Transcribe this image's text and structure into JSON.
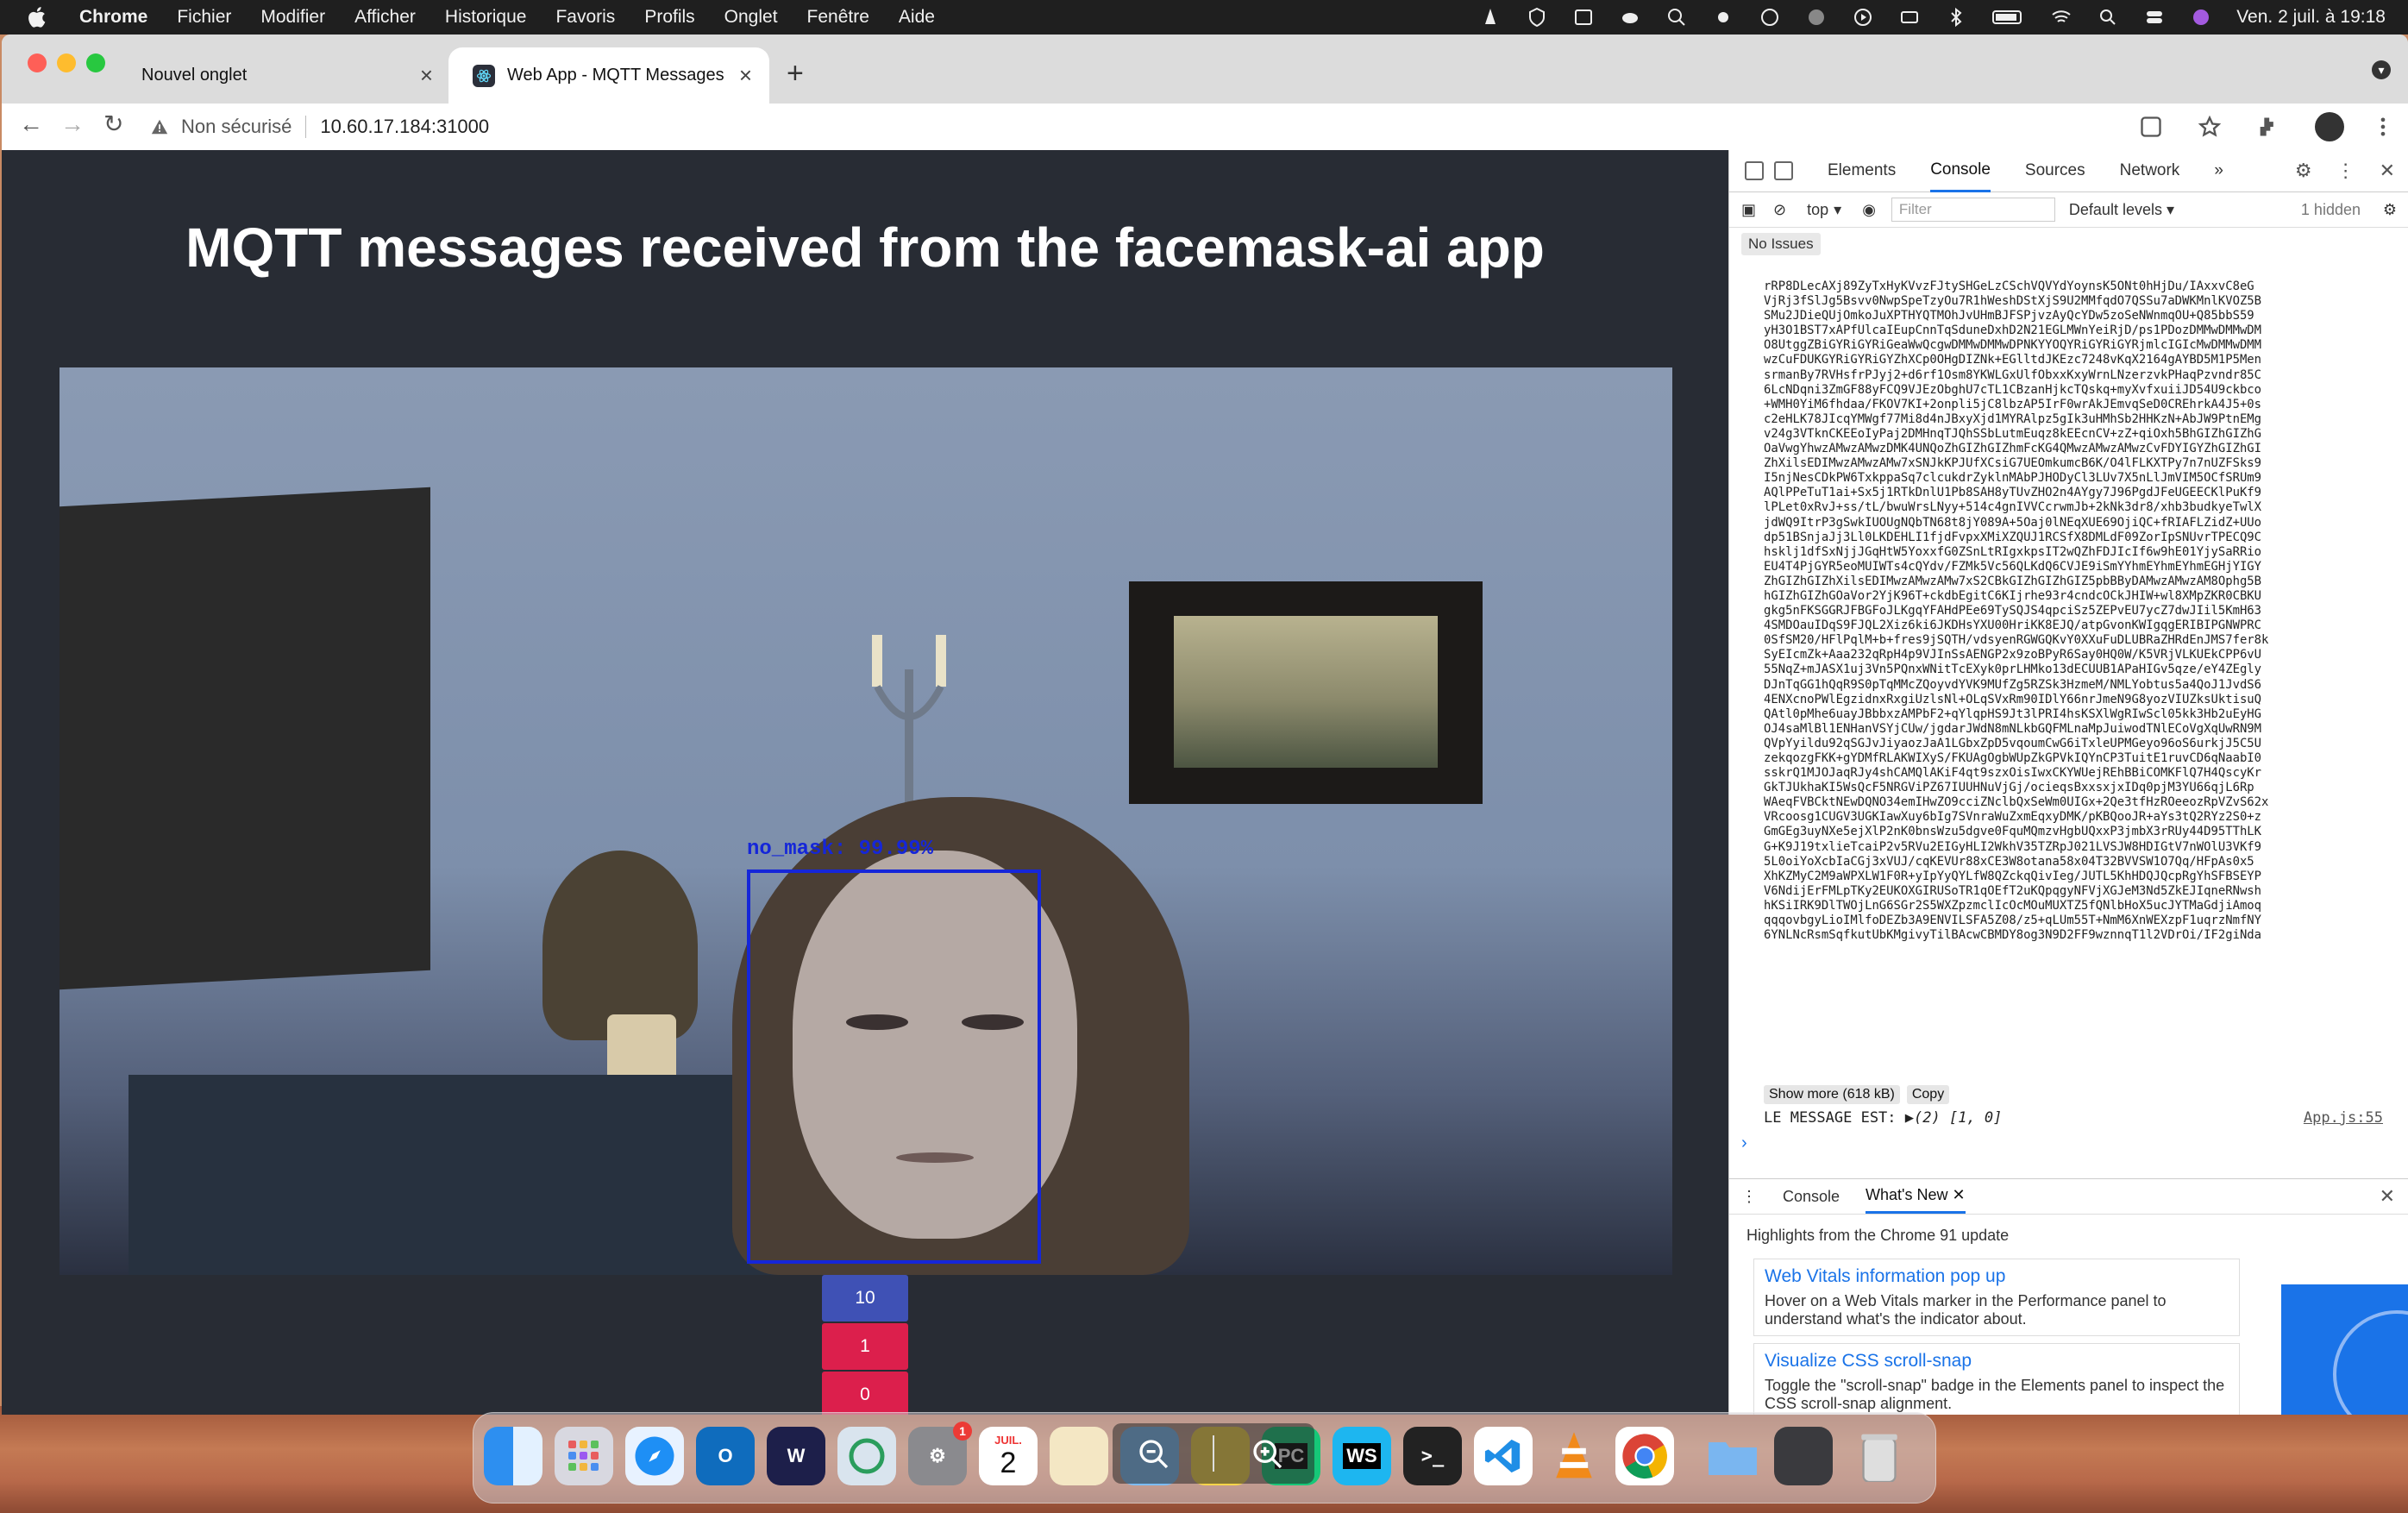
{
  "menubar": {
    "app_name": "Chrome",
    "items": [
      "Fichier",
      "Modifier",
      "Afficher",
      "Historique",
      "Favoris",
      "Profils",
      "Onglet",
      "Fenêtre",
      "Aide"
    ],
    "clock": "Ven. 2 juil. à 19:18"
  },
  "browser": {
    "tabs": [
      {
        "label": "Nouvel onglet",
        "active": false
      },
      {
        "label": "Web App - MQTT Messages",
        "active": true
      }
    ],
    "security_label": "Non sécurisé",
    "url": "10.60.17.184:31000"
  },
  "page": {
    "title": "MQTT messages received from the facemask-ai app",
    "detection_label": "no_mask: 99.99%",
    "counts": [
      {
        "value": "10",
        "color": "#3f51b5"
      },
      {
        "value": "1",
        "color": "#dc1f4c"
      },
      {
        "value": "0",
        "color": "#dc1f4c"
      }
    ]
  },
  "devtools": {
    "tabs": [
      "Elements",
      "Console",
      "Sources",
      "Network"
    ],
    "active_tab": "Console",
    "context": "top",
    "filter_placeholder": "Filter",
    "levels": "Default levels",
    "hidden_count": "1 hidden",
    "issues": "No Issues",
    "base64_lines": [
      "rRP8DLecAXj89ZyTxHyKVvzFJtySHGeLzCSchVQVYdYoynsK5ONt0hHjDu/IAxxvC8eG",
      "VjRj3fSlJg5Bsvv0NwpSpeTzyOu7R1hWeshDStXjS9U2MMfqdO7QSSu7aDWKMnlKVOZ5B",
      "SMu2JDieQUjOmkoJuXPTHYQTMOhJvUHmBJFSPjvzAyQcYDw5zoSeNWnmqOU+Q85bbS59",
      "yH3O1BST7xAPfUlcaIEupCnnTqSduneDxhD2N21EGLMWnYeiRjD/ps1PDozDMMwDMMwDM",
      "O8UtggZBiGYRiGYRiGeaWwQcgwDMMwDMMwDPNKYYOQYRiGYRiGYRjmlcIGIcMwDMMwDMM",
      "wzCuFDUKGYRiGYRiGYZhXCp0OHgDIZNk+EGlltdJKEzc7248vKqX2164gAYBD5M1P5Men",
      "srmanBy7RVHsfrPJyj2+d6rf1Osm8YKWLGxUlfObxxKxyWrnLNzerzvkPHaqPzvndr85C",
      "6LcNDqni3ZmGF88yFCQ9VJEzObghU7cTL1CBzanHjkcTQskq+myXvfxuiiJD54U9ckbco",
      "+WMH0YiM6fhdaa/FKOV7KI+2onpli5jC8lbzAP5IrF0wrAkJEmvqSeD0CREhrkA4J5+0s",
      "c2eHLK78JIcqYMWgf77Mi8d4nJBxyXjd1MYRAlpz5gIk3uHMhSb2HHKzN+AbJW9PtnEMg",
      "v24g3VTknCKEEoIyPaj2DMHnqTJQhSSbLutmEuqz8kEEcnCV+zZ+qiOxh5BhGIZhGIZhG",
      "OaVwgYhwzAMwzAMwzDMK4UNQoZhGIZhGIZhmFcKG4QMwzAMwzAMwzCvFDYIGYZhGIZhGI",
      "ZhXilsEDIMwzAMwzAMw7xSNJkKPJUfXCsiG7UEOmkumcB6K/O4lFLKXTPy7n7nUZFSks9",
      "I5njNesCDkPW6TxkppaSq7clcukdrZyklnMAbPJHODyCl3LUv7X5nLlJmVIM5OCfSRUm9",
      "AQlPPeTuT1ai+Sx5j1RTkDnlU1Pb8SAH8yTUvZHO2n4AYgy7J96PgdJFeUGEECKlPuKf9",
      "lPLet0xRvJ+ss/tL/bwuWrsLNyy+514c4gnIVVCcrwmJb+2kNk3dr8/xhb3budkyeTwlX",
      "jdWQ9ItrP3gSwkIUOUgNQbTN68t8jY089A+5Oaj0lNEqXUE69OjiQC+fRIAFLZidZ+UUo",
      "dp51BSnjaJj3Ll0LKDEHLI1fjdFvpxXMiXZQUJ1RCSfX8DMLdF09ZorIpSNUvrTPECQ9C",
      "hsklj1dfSxNjjJGqHtW5YoxxfG0ZSnLtRIgxkpsIT2wQZhFDJIcIf6w9hE01YjySaRRio",
      "EU4T4PjGYR5eoMUIWTs4cQYdv/FZMk5Vc56QLKdQ6CVJE9iSmYYhmEYhmEYhmEGHjYIGY",
      "ZhGIZhGIZhXilsEDIMwzAMwzAMw7xS2CBkGIZhGIZhGIZ5pbBByDAMwzAMwzAM8Ophg5B",
      "hGIZhGIZhGOaVor2YjK96T+ckdbEgitC6KIjrhe93r4cndcOCkJHIW+wl8XMpZKR0CBKU",
      "gkg5nFKSGGRJFBGFoJLKgqYFAHdPEe69TySQJS4qpciSz5ZEPvEU7ycZ7dwJIil5KmH63",
      "4SMDOauIDqS9FJQL2Xiz6ki6JKDHsYXU00HriKK8EJQ/atpGvonKWIgqgERIBIPGNWPRC",
      "0SfSM20/HFlPqlM+b+fres9jSQTH/vdsyenRGWGQKvY0XXuFuDLUBRaZHRdEnJMS7fer8k",
      "SyEIcmZk+Aaa232qRpH4p9VJInSsAENGP2x9zoBPyR6Say0HQ0W/K5VRjVLKUEkCPP6vU",
      "55NqZ+mJASX1uj3Vn5PQnxWNitTcEXyk0prLHMko13dECUUB1APaHIGv5qze/eY4ZEgly",
      "DJnTqGG1hQqR9S0pTqMMcZQoyvdYVK9MUfZg5RZSk3HzmeM/NMLYobtus5a4QoJ1JvdS6",
      "4ENXcnoPWlEgzidnxRxgiUzlsNl+OLqSVxRm90IDlY66nrJmeN9G8yozVIUZksUktisuQ",
      "QAtl0pMhe6uayJBbbxzAMPbF2+qYlqpHS9Jt3lPRI4hsKSXlWgRIwScl05kk3Hb2uEyHG",
      "OJ4saMlBl1ENHanVSYjCUw/jgdarJWdN8mNLkbGQFMLnaMpJuiwodTNlECoVgXqUwRN9M",
      "QVpYyildu92qSGJvJiyaozJaA1LGbxZpD5vqoumCwG6iTxleUPMGeyo96oS6urkjJ5C5U",
      "zekqozgFKK+gYDMfRLAKWIXyS/FKUAgOgbWUpZkGPVkIQYnCP3TuitE1ruvCD6qNaabI0",
      "sskrQ1MJOJaqRJy4shCAMQlAKiF4qt9szxOisIwxCKYWUejREhBBiCOMKFlQ7H4QscyKr",
      "GkTJUkhaKI5WsQcF5NRGViPZ67IUUHNuVjGj/ocieqsBxxsxjxIDq0pjM3YU66qjL6Rp",
      "WAeqFVBCktNEwDQNO34emIHwZO9cciZNclbQxSeWm0UIGx+2Qe3tfHzROeeozRpVZvS62x",
      "VRcoosg1CUGV3UGKIawXuy6bIg7SVnraWuZxmEqxyDMK/pKBQooJR+aYs3tQ2RYz2S0+z",
      "GmGEg3uyNXe5ejXlP2nK0bnsWzu5dgve0FquMQmzvHgbUQxxP3jmbX3rRUy44D95TThLK",
      "G+K9J19txlieTcaiP2v5RVu2EIGyHLI2WkhV35TZRpJ021LVSJW8HDIGtV7nWOlU3VKf9",
      "5L0oiYoXcbIaCGj3xVUJ/cqKEVUr88xCE3W8otana58x04T32BVVSW1O7Qq/HFpAs0x5",
      "XhKZMyC2M9aWPXLW1F0R+yIpYyQYLfW8QZckqQivIeg/JUTL5KhHDQJQcpRgYhSFBSEYP",
      "V6NdijErFMLpTKy2EUKOXGIRUSoTR1qOEfT2uKQpqgyNFVjXGJeM3Nd5ZkEJIqneRNwsh",
      "hKSiIRK9DlTWOjLnG6SGr2S5WXZpzmclIcOcMOuMUXTZ5fQNlbHoX5ucJYTMaGdjiAmoq",
      "qqqovbgyLioIMlfoDEZb3A9ENVILSFA5Z08/z5+qLUm55T+NmM6XnWEXzpF1uqrzNmfNY",
      "6YNLNcRsmSqfkutUbKMgivyTilBAcwCBMDY8og3N9D2FF9wznnqT1l2VDrOi/IF2giNda"
    ],
    "show_more": "Show more (618 kB)",
    "copy": "Copy",
    "log_message_label": "LE MESSAGE EST:",
    "log_message_value": "▶(2) [1, 0]",
    "log_source": "App.js:55",
    "drawer": {
      "tabs": [
        "Console",
        "What's New"
      ],
      "highlights": "Highlights from the Chrome 91 update",
      "cards": [
        {
          "title": "Web Vitals information pop up",
          "desc": "Hover on a Web Vitals marker in the Performance panel to understand what's the indicator about."
        },
        {
          "title": "Visualize CSS scroll-snap",
          "desc": "Toggle the \"scroll-snap\" badge in the Elements panel to inspect the CSS scroll-snap alignment."
        }
      ]
    }
  },
  "dock": {
    "calendar_month": "JUIL.",
    "calendar_day": "2",
    "settings_badge": "1",
    "pycharm_label": "PC",
    "webstorm_label": "WS"
  }
}
